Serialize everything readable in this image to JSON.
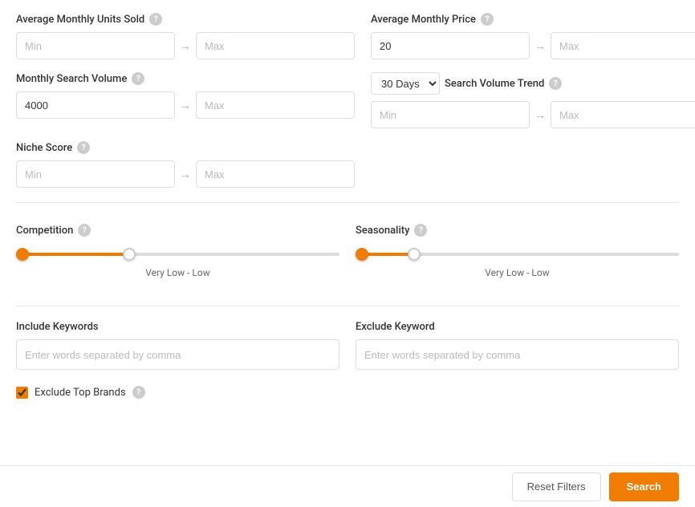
{
  "fields": {
    "avg_monthly_units": {
      "label": "Average Monthly Units Sold",
      "min_placeholder": "Min",
      "max_placeholder": "Max",
      "min_value": "",
      "max_value": ""
    },
    "avg_monthly_price": {
      "label": "Average Monthly Price",
      "min_value": "20",
      "max_placeholder": "Max"
    },
    "monthly_search_volume": {
      "label": "Monthly Search Volume",
      "min_value": "4000",
      "max_placeholder": "Max"
    },
    "search_volume_trend": {
      "dropdown_label": "30 Days",
      "label": "Search Volume Trend",
      "min_placeholder": "Min",
      "max_placeholder": "Max"
    },
    "niche_score": {
      "label": "Niche Score",
      "min_placeholder": "Min",
      "max_placeholder": "Max"
    }
  },
  "sliders": {
    "competition": {
      "label": "Competition",
      "value_label": "Very Low  -  Low"
    },
    "seasonality": {
      "label": "Seasonality",
      "value_label": "Very Low  -  Low"
    }
  },
  "keywords": {
    "include": {
      "label": "Include Keywords",
      "placeholder": "Enter words separated by comma"
    },
    "exclude": {
      "label": "Exclude Keyword",
      "placeholder": "Enter words separated by comma"
    }
  },
  "exclude_brands": {
    "label": "Exclude Top Brands",
    "checked": true
  },
  "buttons": {
    "reset": "Reset Filters",
    "search": "Search"
  }
}
